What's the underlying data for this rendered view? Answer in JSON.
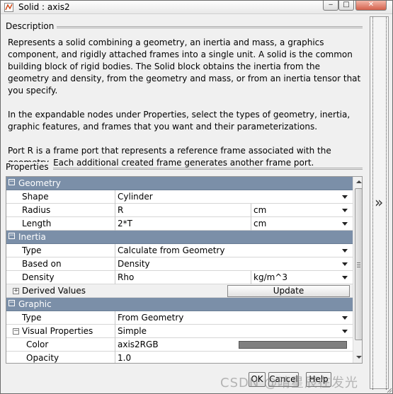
{
  "window": {
    "title": "Solid : axis2"
  },
  "description": {
    "label": "Description",
    "paragraphs": [
      "Represents a solid combining a geometry, an inertia and mass, a graphics component, and rigidly attached frames into a single unit. A solid is the common building block of rigid bodies. The Solid block obtains the inertia from the geometry and density, from the geometry and mass, or from an inertia tensor that you specify.",
      "In the expandable nodes under Properties, select the types of geometry, inertia, graphic features, and frames that you want and their parameterizations.",
      "Port R is a frame port that represents a reference frame associated with the geometry. Each additional created frame generates another frame port."
    ]
  },
  "properties": {
    "label": "Properties",
    "geometry": {
      "header": "Geometry",
      "shape": {
        "name": "Shape",
        "value": "Cylinder"
      },
      "radius": {
        "name": "Radius",
        "value": "R",
        "unit": "cm"
      },
      "length": {
        "name": "Length",
        "value": "2*T",
        "unit": "cm"
      }
    },
    "inertia": {
      "header": "Inertia",
      "type": {
        "name": "Type",
        "value": "Calculate from Geometry"
      },
      "based_on": {
        "name": "Based on",
        "value": "Density"
      },
      "density": {
        "name": "Density",
        "value": "Rho",
        "unit": "kg/m^3"
      },
      "derived": {
        "name": "Derived Values",
        "button": "Update"
      }
    },
    "graphic": {
      "header": "Graphic",
      "type": {
        "name": "Type",
        "value": "From Geometry"
      },
      "visual": {
        "name": "Visual Properties",
        "value": "Simple"
      },
      "color": {
        "name": "Color",
        "value": "axis2RGB",
        "swatch": "#808080"
      },
      "opacity": {
        "name": "Opacity",
        "value": "1.0"
      }
    }
  },
  "buttons": {
    "ok": "OK",
    "cancel": "Cancel",
    "help": "Help"
  },
  "watermark": "CSDN @晴星辰在发光",
  "colors": {
    "category_header": "#7b8fa8",
    "window_bg": "#f0f0f0"
  }
}
